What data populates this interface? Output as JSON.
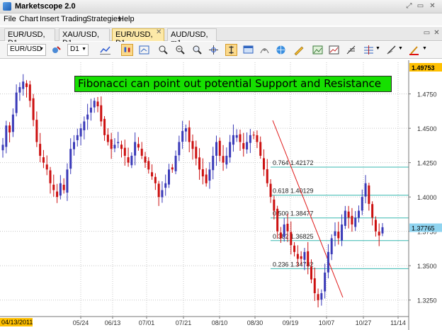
{
  "window": {
    "title": "Marketscope 2.0",
    "controls": [
      "⤢",
      "▭",
      "✕"
    ]
  },
  "menu": [
    "File",
    "Chart",
    "Insert",
    "Trading",
    "Strategies",
    "Help"
  ],
  "tabs": [
    {
      "label": "EUR/USD, D1",
      "active": false
    },
    {
      "label": "XAU/USD, D1",
      "active": false
    },
    {
      "label": "EUR/USD, D1",
      "active": true
    },
    {
      "label": "AUD/USD, m1",
      "active": false
    }
  ],
  "toolbar": {
    "symbol": "EUR/USD",
    "timeframe": "D1"
  },
  "chart": {
    "annotation": "Fibonacci can point out potential Support and Resistance",
    "y_ticks": [
      "1.4750",
      "1.4500",
      "1.4250",
      "1.4000",
      "1.3750",
      "1.3500",
      "1.3250"
    ],
    "x_ticks": [
      "05/24",
      "06/13",
      "07/01",
      "07/21",
      "08/10",
      "08/30",
      "09/19",
      "10/07",
      "10/27",
      "11/14"
    ],
    "high_label": "1.49753",
    "last_label": "1.37765",
    "start_date": "04/13/2011",
    "fib_levels": [
      {
        "label": "0.764 1.42172",
        "value": 1.42172
      },
      {
        "label": "0.618 1.40129",
        "value": 1.40129
      },
      {
        "label": "0.500 1.38477",
        "value": 1.38477
      },
      {
        "label": "0.382 1.36825",
        "value": 1.36825
      },
      {
        "label": "0.236 1.34782",
        "value": 1.34782
      }
    ],
    "colors": {
      "up": "#3a3ab8",
      "down": "#cc1010",
      "fib": "#38b8b0",
      "trend": "#e01818",
      "high": "#ffc000",
      "last": "#8fd4f0"
    }
  },
  "chart_data": {
    "type": "candlestick",
    "x": [
      "04/13/2011",
      "05/24",
      "06/13",
      "07/01",
      "07/21",
      "08/10",
      "08/30",
      "09/19",
      "10/07",
      "10/27",
      "11/14"
    ],
    "ylim": [
      1.313,
      1.498
    ],
    "close_path": [
      1.438,
      1.452,
      1.447,
      1.46,
      1.476,
      1.48,
      1.484,
      1.48,
      1.47,
      1.456,
      1.44,
      1.43,
      1.425,
      1.42,
      1.41,
      1.405,
      1.4,
      1.41,
      1.405,
      1.42,
      1.435,
      1.44,
      1.445,
      1.45,
      1.455,
      1.46,
      1.465,
      1.47,
      1.466,
      1.455,
      1.445,
      1.44,
      1.435,
      1.438,
      1.44,
      1.435,
      1.43,
      1.425,
      1.43,
      1.44,
      1.436,
      1.43,
      1.425,
      1.42,
      1.415,
      1.41,
      1.4,
      1.405,
      1.41,
      1.42,
      1.42,
      1.43,
      1.44,
      1.448,
      1.45,
      1.44,
      1.435,
      1.428,
      1.42,
      1.415,
      1.41,
      1.42,
      1.43,
      1.44,
      1.43,
      1.425,
      1.43,
      1.44,
      1.445,
      1.445,
      1.44,
      1.435,
      1.44,
      1.445,
      1.445,
      1.44,
      1.43,
      1.42,
      1.41,
      1.4,
      1.39,
      1.375,
      1.37,
      1.38,
      1.375,
      1.365,
      1.36,
      1.355,
      1.355,
      1.36,
      1.35,
      1.34,
      1.33,
      1.325,
      1.33,
      1.345,
      1.36,
      1.37,
      1.375,
      1.37,
      1.38,
      1.39,
      1.385,
      1.38,
      1.385,
      1.39,
      1.4,
      1.41,
      1.395,
      1.385,
      1.375,
      1.372,
      1.378
    ]
  }
}
